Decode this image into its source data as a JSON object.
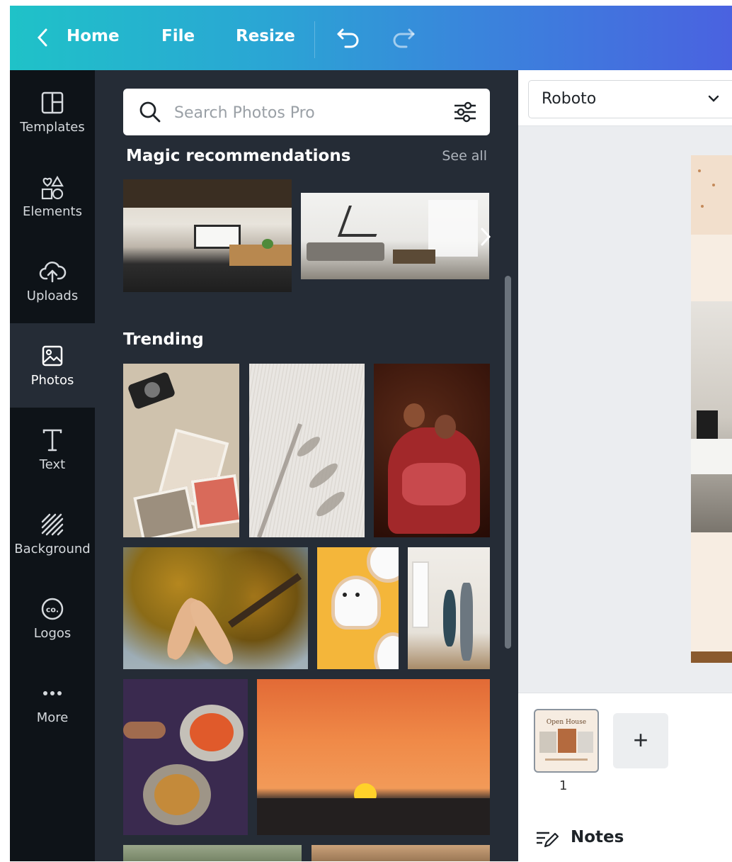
{
  "header": {
    "home_label": "Home",
    "file_label": "File",
    "resize_label": "Resize",
    "icons": [
      "chevron-left-icon",
      "undo-icon",
      "redo-icon"
    ]
  },
  "sidebar": {
    "items": [
      {
        "label": "Templates",
        "icon": "templates-icon"
      },
      {
        "label": "Elements",
        "icon": "elements-icon"
      },
      {
        "label": "Uploads",
        "icon": "cloud-upload-icon"
      },
      {
        "label": "Photos",
        "icon": "photo-icon",
        "active": true
      },
      {
        "label": "Text",
        "icon": "text-icon"
      },
      {
        "label": "Background",
        "icon": "background-icon"
      },
      {
        "label": "Logos",
        "icon": "logo-icon"
      },
      {
        "label": "More",
        "icon": "more-icon"
      }
    ]
  },
  "panel": {
    "search": {
      "placeholder": "Search Photos Pro",
      "value": ""
    },
    "magic": {
      "title": "Magic recommendations",
      "see_all": "See all"
    },
    "trending": {
      "title": "Trending"
    }
  },
  "editor": {
    "font_name": "Roboto",
    "page_number": "1",
    "thumb_title": "Open House",
    "add_page": "+",
    "notes_label": "Notes"
  },
  "colors": {
    "header_gradient_start": "#1fc2c8",
    "header_gradient_end": "#4a62e0",
    "rail_bg": "#0e1318",
    "panel_bg": "#252c36"
  }
}
